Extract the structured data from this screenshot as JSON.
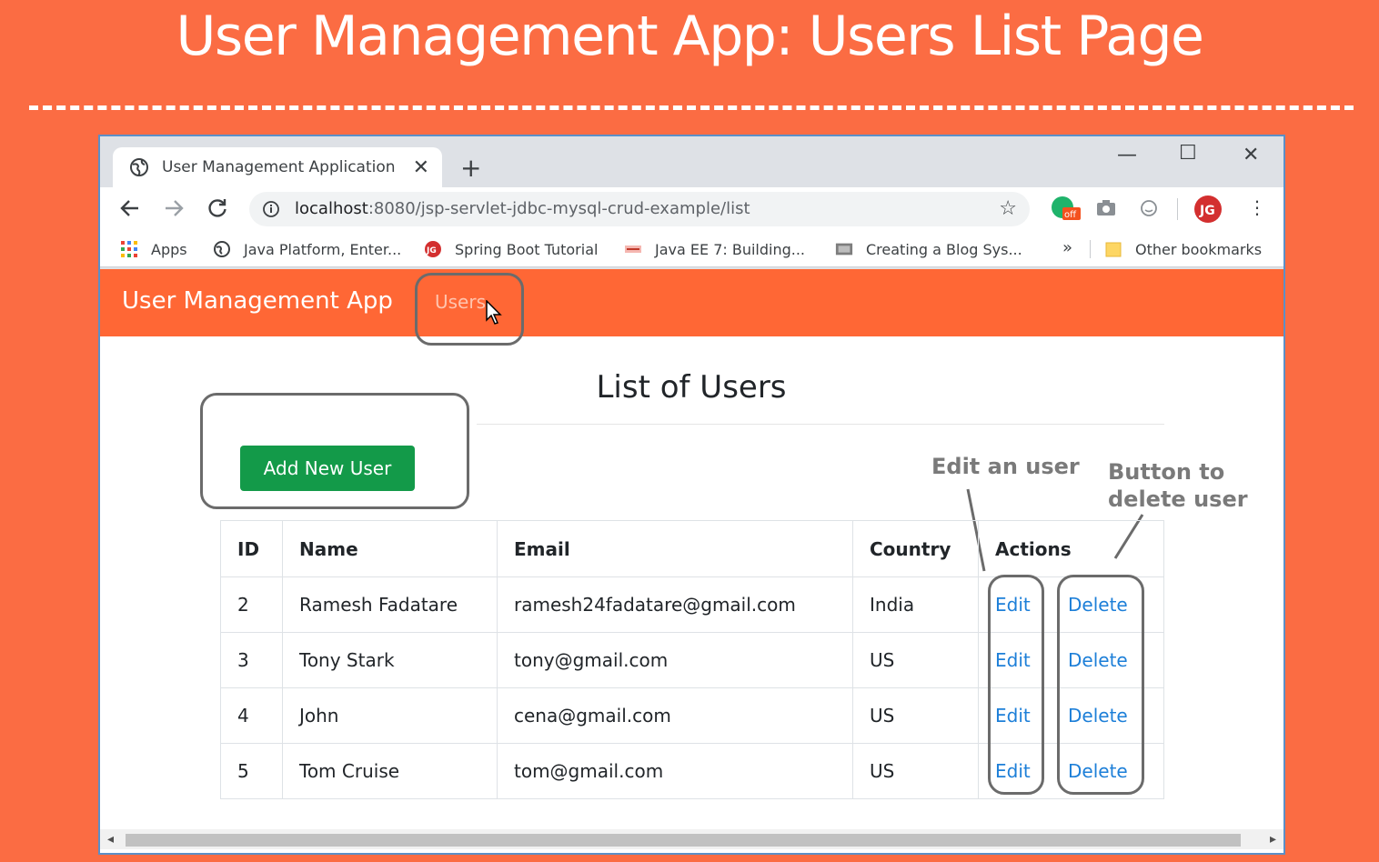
{
  "slide": {
    "title": "User Management App: Users List Page"
  },
  "browser": {
    "tab_title": "User Management Application",
    "url_host": "localhost",
    "url_rest": ":8080/jsp-servlet-jdbc-mysql-crud-example/list",
    "bookmarks": [
      {
        "label": "Apps",
        "icon": "apps-grid-icon"
      },
      {
        "label": "Java Platform, Enter...",
        "icon": "globe-icon"
      },
      {
        "label": "Spring Boot Tutorial",
        "icon": "jg-logo-icon"
      },
      {
        "label": "Java EE 7: Building...",
        "icon": "oracle-icon"
      },
      {
        "label": "Creating a Blog Sys...",
        "icon": "site-icon"
      }
    ],
    "overflow": "»",
    "other_bookmarks": "Other bookmarks",
    "extension_badge": "off"
  },
  "navbar": {
    "brand": "User Management App",
    "users_link": "Users"
  },
  "page": {
    "heading": "List of Users",
    "add_button": "Add New User"
  },
  "annotations": {
    "edit_note": "Edit an user",
    "delete_note_line1": "Button to",
    "delete_note_line2": "delete user"
  },
  "table": {
    "headers": [
      "ID",
      "Name",
      "Email",
      "Country",
      "Actions"
    ],
    "rows": [
      {
        "id": "2",
        "name": "Ramesh Fadatare",
        "email": "ramesh24fadatare@gmail.com",
        "country": "India",
        "edit": "Edit",
        "delete": "Delete"
      },
      {
        "id": "3",
        "name": "Tony Stark",
        "email": "tony@gmail.com",
        "country": "US",
        "edit": "Edit",
        "delete": "Delete"
      },
      {
        "id": "4",
        "name": "John",
        "email": "cena@gmail.com",
        "country": "US",
        "edit": "Edit",
        "delete": "Delete"
      },
      {
        "id": "5",
        "name": "Tom Cruise",
        "email": "tom@gmail.com",
        "country": "US",
        "edit": "Edit",
        "delete": "Delete"
      }
    ]
  },
  "colors": {
    "slide_background": "#fb6c43",
    "navbar": "#ff6735",
    "add_button": "#139a49",
    "link": "#1d7fd8"
  }
}
